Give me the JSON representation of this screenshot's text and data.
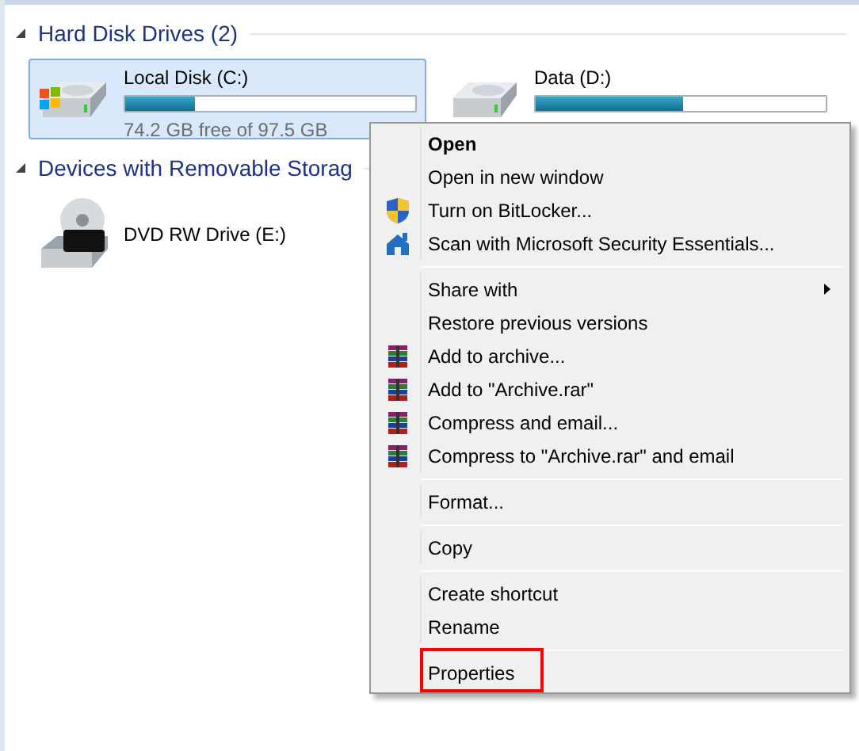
{
  "sections": [
    {
      "title": "Hard Disk Drives (2)",
      "expanded": true,
      "drives": [
        {
          "kind": "windows-disk",
          "name": "Local Disk (C:)",
          "level": 0.24,
          "free": "74.2 GB free of 97.5 GB",
          "selected": true
        },
        {
          "kind": "disk",
          "name": "Data (D:)",
          "level": 0.51,
          "selected": false
        }
      ]
    },
    {
      "title": "Devices with Removable Storag",
      "expanded": true,
      "drives": [
        {
          "kind": "dvd",
          "name": "DVD RW Drive (E:)",
          "selected": false
        }
      ]
    }
  ],
  "context_menu": [
    {
      "kind": "item",
      "label": "Open",
      "bold": true
    },
    {
      "kind": "item",
      "label": "Open in new window"
    },
    {
      "kind": "shield",
      "label": "Turn on BitLocker..."
    },
    {
      "kind": "scan",
      "label": "Scan with Microsoft Security Essentials..."
    },
    {
      "kind": "separator"
    },
    {
      "kind": "item",
      "label": "Share with",
      "submenu": true
    },
    {
      "kind": "item",
      "label": "Restore previous versions"
    },
    {
      "kind": "archive",
      "label": "Add to archive..."
    },
    {
      "kind": "archive",
      "label": "Add to \"Archive.rar\""
    },
    {
      "kind": "archive",
      "label": "Compress and email..."
    },
    {
      "kind": "archive",
      "label": "Compress to \"Archive.rar\" and email"
    },
    {
      "kind": "separator"
    },
    {
      "kind": "item",
      "label": "Format..."
    },
    {
      "kind": "separator"
    },
    {
      "kind": "item",
      "label": "Copy"
    },
    {
      "kind": "separator"
    },
    {
      "kind": "item",
      "label": "Create shortcut"
    },
    {
      "kind": "item",
      "label": "Rename"
    },
    {
      "kind": "separator"
    },
    {
      "kind": "item",
      "label": "Properties",
      "highlighted": true
    }
  ]
}
